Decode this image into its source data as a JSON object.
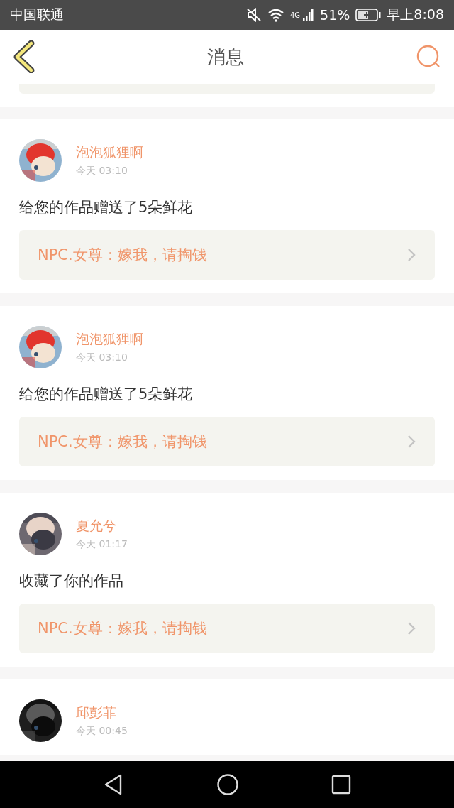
{
  "status_bar": {
    "carrier": "中国联通",
    "network": "4G",
    "battery": "51%",
    "time": "早上8:08"
  },
  "header": {
    "title": "消息"
  },
  "messages": [
    {
      "name": "泡泡狐狸啊",
      "time": "今天 03:10",
      "text": "给您的作品赠送了5朵鲜花",
      "work": "NPC.女尊：嫁我，请掏钱"
    },
    {
      "name": "泡泡狐狸啊",
      "time": "今天 03:10",
      "text": "给您的作品赠送了5朵鲜花",
      "work": "NPC.女尊：嫁我，请掏钱"
    },
    {
      "name": "夏允兮",
      "time": "今天 01:17",
      "text": "收藏了你的作品",
      "work": "NPC.女尊：嫁我，请掏钱"
    },
    {
      "name": "邱彭菲",
      "time": "今天 00:45"
    }
  ]
}
